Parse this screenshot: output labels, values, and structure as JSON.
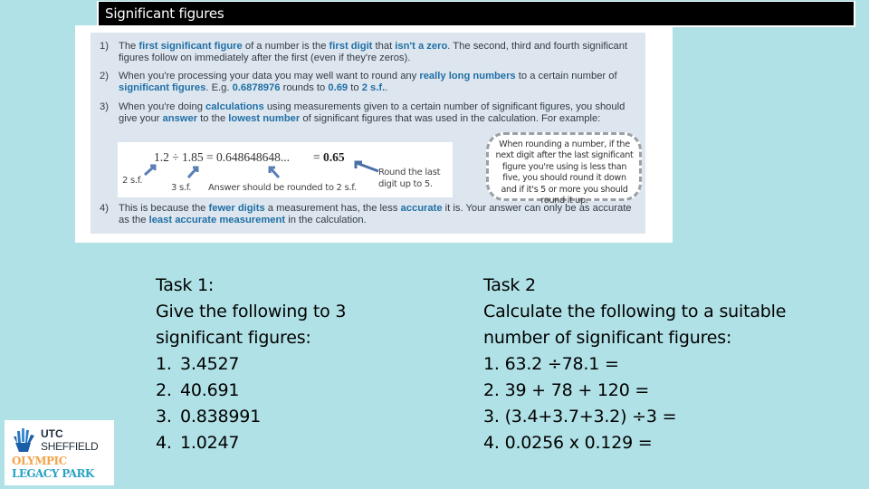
{
  "title": "Significant figures",
  "book": {
    "points": [
      {
        "num": "1)",
        "parts": [
          {
            "t": "The "
          },
          {
            "t": "first significant figure",
            "hl": true
          },
          {
            "t": " of a number is the "
          },
          {
            "t": "first digit",
            "hl": true
          },
          {
            "t": " that "
          },
          {
            "t": "isn't a zero",
            "hl": true
          },
          {
            "t": ".  The second, third and fourth significant figures follow on immediately after the first (even if they're zeros)."
          }
        ]
      },
      {
        "num": "2)",
        "parts": [
          {
            "t": "When you're processing your data you may well want to round any "
          },
          {
            "t": "really long numbers",
            "hl": true
          },
          {
            "t": " to a certain number of "
          },
          {
            "t": "significant figures",
            "hl": true
          },
          {
            "t": ".  E.g. "
          },
          {
            "t": "0.6878976",
            "hl": true
          },
          {
            "t": " rounds to "
          },
          {
            "t": "0.69",
            "hl": true
          },
          {
            "t": " to "
          },
          {
            "t": "2 s.f.",
            "hl": true
          },
          {
            "t": "."
          }
        ]
      },
      {
        "num": "3)",
        "parts": [
          {
            "t": "When you're doing "
          },
          {
            "t": "calculations",
            "hl": true
          },
          {
            "t": " using measurements given to a certain number of significant figures, you should give your "
          },
          {
            "t": "answer",
            "hl": true
          },
          {
            "t": " to the "
          },
          {
            "t": "lowest number",
            "hl": true
          },
          {
            "t": " of significant figures that was used in the calculation. For example:"
          }
        ]
      },
      {
        "num": "4)",
        "parts": [
          {
            "t": "This is because the "
          },
          {
            "t": "fewer digits",
            "hl": true
          },
          {
            "t": " a measurement has, the less "
          },
          {
            "t": "accurate",
            "hl": true
          },
          {
            "t": " it is. Your answer can only be as accurate as the "
          },
          {
            "t": "least accurate measurement",
            "hl": true
          },
          {
            "t": " in the calculation."
          }
        ]
      }
    ],
    "example": {
      "equation": "1.2 ÷ 1.85 = 0.648648648...",
      "answer_prefix": "= ",
      "answer": "0.65",
      "note_2sf": "2 s.f.",
      "note_3sf": "3 s.f.",
      "note_answer": "Answer should be rounded to 2 s.f.",
      "note_round_1": "Round the last",
      "note_round_2": "digit up to 5."
    },
    "callout": "When rounding a number, if the next digit after the last significant figure you're using is less than five, you should round it down and if it's 5 or more you should round it up."
  },
  "task1": {
    "heading": "Task 1:",
    "instruction_1": "Give the following to 3",
    "instruction_2": "significant figures:",
    "items": [
      {
        "n": "1.",
        "v": "3.4527"
      },
      {
        "n": "2.",
        "v": "40.691"
      },
      {
        "n": "3.",
        "v": "0.838991"
      },
      {
        "n": "4.",
        "v": "1.0247"
      }
    ]
  },
  "task2": {
    "heading": "Task 2",
    "instruction_1": "Calculate the following to a suitable",
    "instruction_2": "number of significant figures:",
    "items": [
      "1. 63.2 ÷78.1 =",
      "2. 39 + 78 + 120 =",
      "3. (3.4+3.7+3.2) ÷3 =",
      "4. 0.0256 x 0.129 ="
    ]
  },
  "logo": {
    "line1": "UTC",
    "line2": "SHEFFIELD",
    "line3": "OLYMPIC",
    "line4": "LEGACY PARK"
  },
  "colors": {
    "background": "#b0e1e6",
    "highlight": "#1f6fa6",
    "olympic": "#f2a44a",
    "legacy": "#2aa3c5"
  }
}
